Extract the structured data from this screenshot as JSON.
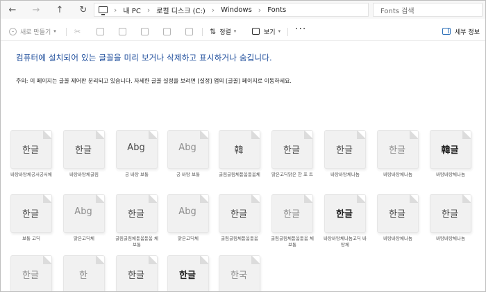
{
  "nav": {
    "back": "←",
    "forward": "→",
    "up": "↑",
    "refresh": "↻"
  },
  "address": {
    "crumbs": [
      "내 PC",
      "로컬 디스크 (C:)",
      "Windows",
      "Fonts"
    ],
    "separator": "›"
  },
  "search": {
    "placeholder": "Fonts 검색"
  },
  "toolbar": {
    "new_label": "새로 만들기",
    "sort_label": "정렬",
    "view_label": "보기",
    "more_label": "···",
    "details_label": "세부 정보"
  },
  "content": {
    "headline": "컴퓨터에 설치되어 있는 글꼴을 미리 보거나 삭제하고 표시하거나 숨깁니다.",
    "note": "주의: 이 페이지는 글꼴 제어판 분리되고 있습니다. 자세한 글꼴 설정을 보려면 [설정] 앱의 [글꼴] 페이지로 이동하세요."
  },
  "fonts": [
    {
      "glyph": "한글",
      "label": "바탕바탕체궁서궁서체"
    },
    {
      "glyph": "한글",
      "label": "바탕바탕체굴림"
    },
    {
      "glyph": "Abg",
      "label": "궁 바탕 보통"
    },
    {
      "glyph": "Abg",
      "label": "궁 바탕 보통"
    },
    {
      "glyph": "韓",
      "label": "굴림굴림체돋움돋움체"
    },
    {
      "glyph": "한글",
      "label": "맑은고딕맑은 한 포 트"
    },
    {
      "glyph": "한글",
      "label": "바탕바탕체나눔"
    },
    {
      "glyph": "한글",
      "label": "바탕바탕체나눔"
    },
    {
      "glyph": "韓글",
      "label": "바탕바탕체나눔"
    },
    {
      "glyph": "한글",
      "label": "보통 고딕"
    },
    {
      "glyph": "Abg",
      "label": "맑은고딕체"
    },
    {
      "glyph": "한글",
      "label": "굴림굴림체돋움돋움 체 보통"
    },
    {
      "glyph": "Abg",
      "label": "맑은고딕체"
    },
    {
      "glyph": "한글",
      "label": "굴림굴림체돋움돋움"
    },
    {
      "glyph": "한글",
      "label": "굴림굴림체돋움돋움 체 보통"
    },
    {
      "glyph": "한글",
      "label": "바탕바탕체나눔고딕 바탕체"
    },
    {
      "glyph": "한글",
      "label": "바탕바탕체나눔"
    },
    {
      "glyph": "한글",
      "label": "바탕바탕체나눔"
    },
    {
      "glyph": "한글",
      "label": ""
    },
    {
      "glyph": "한",
      "label": ""
    },
    {
      "glyph": "한글",
      "label": ""
    },
    {
      "glyph": "한글",
      "label": ""
    },
    {
      "glyph": "한국",
      "label": ""
    }
  ]
}
